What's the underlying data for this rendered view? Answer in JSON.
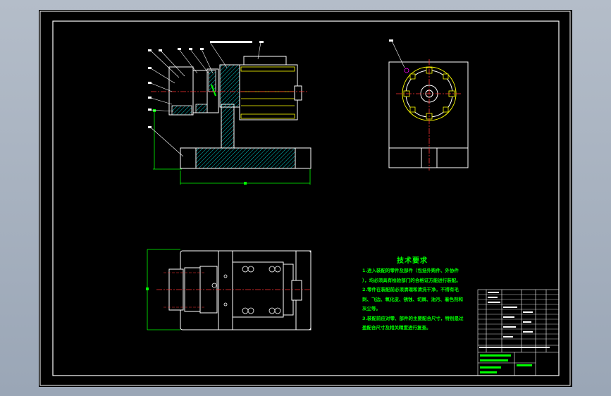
{
  "colors": {
    "background": "#000000",
    "outline": "#ffffff",
    "dimension": "#00ff00",
    "centerline": "#ff3333",
    "hatch": "#00c8c8",
    "part": "#ffff00",
    "balloon": "#ff00ff"
  },
  "technical_requirements": {
    "title": "技术要求",
    "lines": [
      "1.进入装配的零件及部件（包括外购件、外协件",
      "），均必须具有检验部门的合格证方能进行装配。",
      "2.零件在装配前必须清理和清洗干净，不得有毛",
      "刺、飞边、氧化皮、锈蚀、切屑、油污、着色剂和",
      "灰尘等。",
      "3.装配前应对零、部件的主要配合尺寸，特别是过",
      "盈配合尺寸及相关精度进行复查。"
    ]
  }
}
